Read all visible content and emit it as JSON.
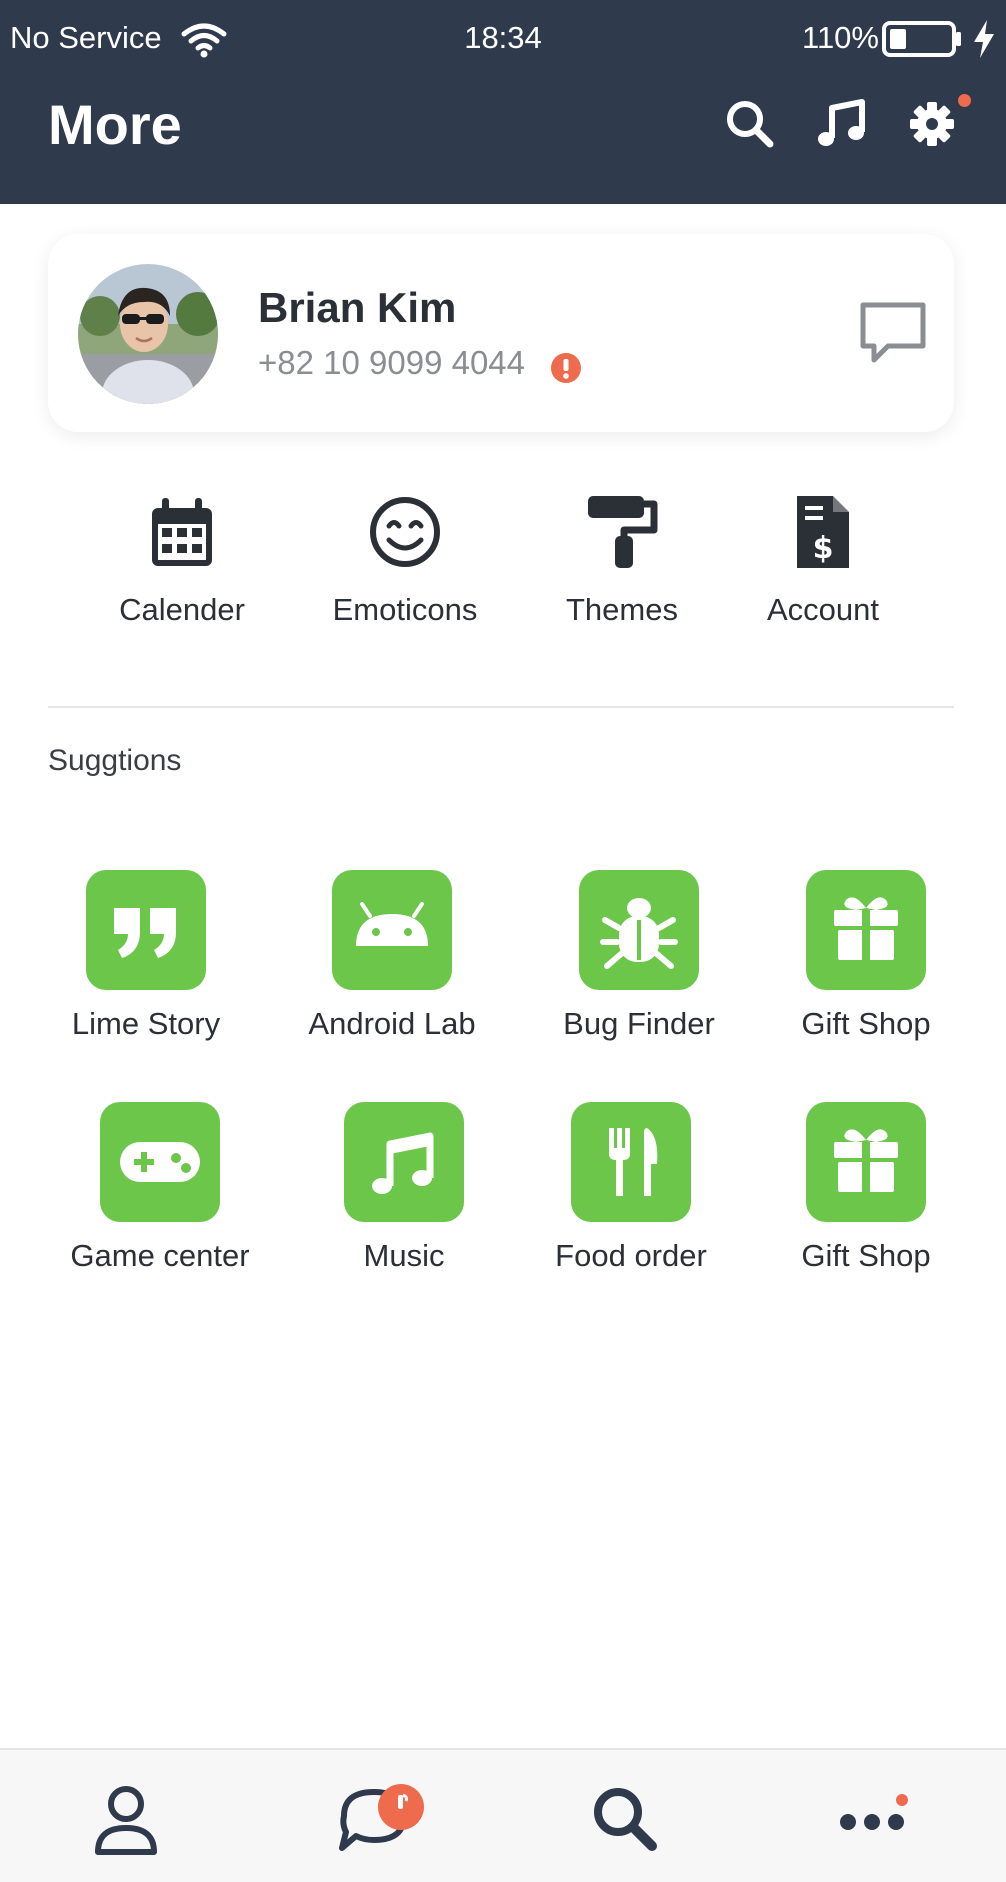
{
  "status_bar": {
    "carrier": "No Service",
    "time": "18:34",
    "battery": "110%"
  },
  "header": {
    "title": "More",
    "icons": [
      "search-icon",
      "music-note-icon",
      "gear-icon"
    ],
    "settings_notification": true
  },
  "profile": {
    "name": "Brian Kim",
    "phone": "+82 10 9099 4044",
    "phone_alert_icon": "exclamation-circle-icon",
    "chat_icon": "chat-bubble-icon"
  },
  "quick_actions": [
    {
      "label": "Calender",
      "icon": "calendar-icon"
    },
    {
      "label": "Emoticons",
      "icon": "smile-icon"
    },
    {
      "label": "Themes",
      "icon": "paint-roller-icon"
    },
    {
      "label": "Account",
      "icon": "invoice-dollar-icon"
    }
  ],
  "suggestions": {
    "title": "Suggtions",
    "items": [
      {
        "label": "Lime Story",
        "icon": "quote-icon"
      },
      {
        "label": "Android Lab",
        "icon": "android-icon"
      },
      {
        "label": "Bug Finder",
        "icon": "bug-icon"
      },
      {
        "label": "Gift Shop",
        "icon": "gift-icon"
      },
      {
        "label": "Game center",
        "icon": "gamepad-icon"
      },
      {
        "label": "Music",
        "icon": "music-note-icon"
      },
      {
        "label": "Food order",
        "icon": "utensils-icon"
      },
      {
        "label": "Gift Shop",
        "icon": "gift-icon"
      }
    ]
  },
  "bottom_nav": {
    "items": [
      "person-icon",
      "chat-icon",
      "search-icon",
      "more-dots-icon"
    ],
    "chat_badge": true,
    "more_dot": true
  },
  "colors": {
    "header_bg": "#2f3a4d",
    "accent_green": "#6cc64a",
    "alert_red": "#ef6b4d",
    "text_dark": "#2b2f36",
    "text_gray": "#8a8d92"
  }
}
